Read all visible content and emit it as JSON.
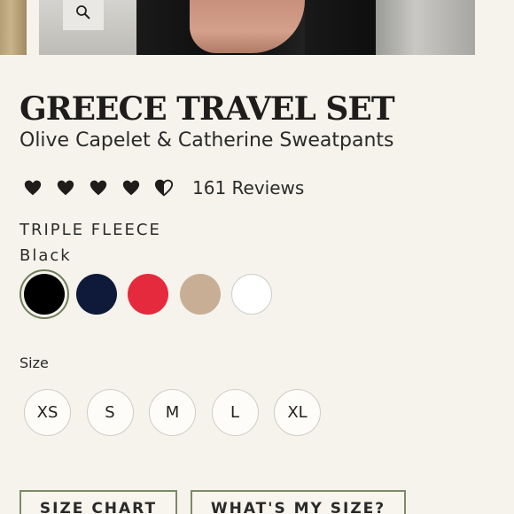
{
  "header": {
    "zoom_icon": "magnifier-icon"
  },
  "product": {
    "title": "GREECE TRAVEL SET",
    "subtitle": "Olive Capelet & Catherine Sweatpants",
    "rating": 4.5,
    "reviews_text": "161 Reviews",
    "fabric": "TRIPLE FLEECE",
    "selected_color": "Black"
  },
  "swatches": [
    {
      "name": "black",
      "hex": "#000000"
    },
    {
      "name": "navy",
      "hex": "#0f1a3a"
    },
    {
      "name": "red",
      "hex": "#e52a3d"
    },
    {
      "name": "tan",
      "hex": "#c9ae96"
    },
    {
      "name": "white",
      "hex": "#ffffff"
    }
  ],
  "sizes": {
    "label": "Size",
    "options": [
      "XS",
      "S",
      "M",
      "L",
      "XL"
    ]
  },
  "buttons": {
    "size_chart": "SIZE CHART",
    "whats_my_size": "WHAT'S MY SIZE?"
  },
  "colors": {
    "background": "#f5f3ec",
    "accent_olive": "#7d8a66"
  }
}
